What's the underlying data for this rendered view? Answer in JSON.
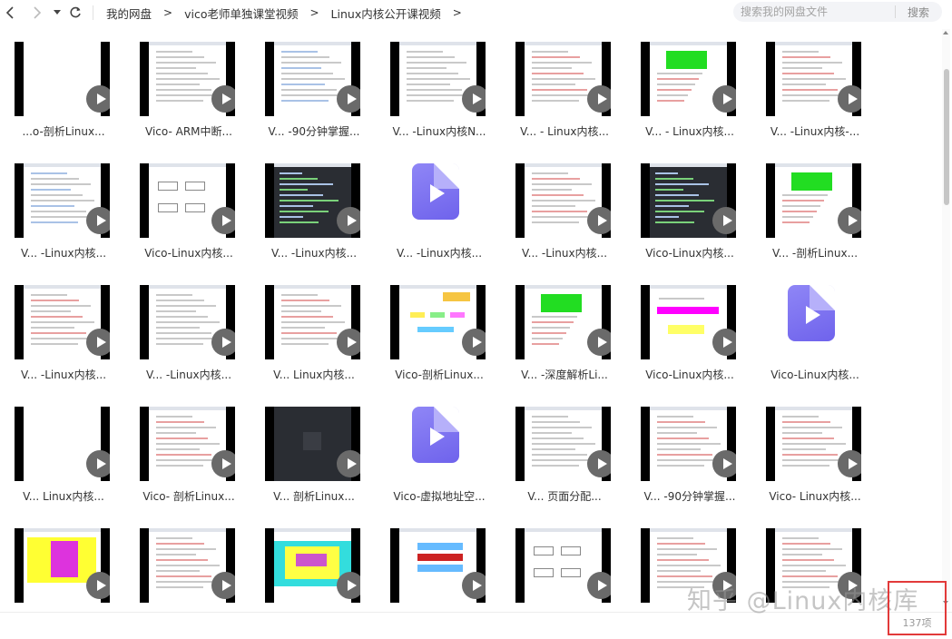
{
  "nav": {
    "back_icon": "chevron-left-icon",
    "forward_icon": "chevron-right-icon",
    "dropdown_icon": "caret-down-icon",
    "refresh_icon": "refresh-icon"
  },
  "breadcrumb": {
    "items": [
      "我的网盘",
      "vico老师单独课堂视频",
      "Linux内核公开课视频"
    ],
    "separator": ">"
  },
  "search": {
    "placeholder": "搜索我的网盘文件",
    "button_label": "搜索"
  },
  "files": [
    {
      "name": "...o-剖析Linux...",
      "kind": "video",
      "thumb": "blank"
    },
    {
      "name": "Vico- ARM中断...",
      "kind": "video",
      "thumb": "doc"
    },
    {
      "name": "V... -90分钟掌握...",
      "kind": "video",
      "thumb": "doc-blue"
    },
    {
      "name": "V... -Linux内核N...",
      "kind": "video",
      "thumb": "doc"
    },
    {
      "name": "V... - Linux内核...",
      "kind": "video",
      "thumb": "doc-red"
    },
    {
      "name": "V... - Linux内核...",
      "kind": "video",
      "thumb": "green-block"
    },
    {
      "name": "V... -Linux内核-...",
      "kind": "video",
      "thumb": "doc-red"
    },
    {
      "name": "V... -Linux内核...",
      "kind": "video",
      "thumb": "doc-blue"
    },
    {
      "name": "Vico-Linux内核...",
      "kind": "video",
      "thumb": "diagram"
    },
    {
      "name": "V... -Linux内核...",
      "kind": "video",
      "thumb": "code"
    },
    {
      "name": "V... -Linux内核...",
      "kind": "file",
      "thumb": "video-file"
    },
    {
      "name": "V... -Linux内核...",
      "kind": "video",
      "thumb": "doc-red"
    },
    {
      "name": "Vico-Linux内核...",
      "kind": "video",
      "thumb": "code"
    },
    {
      "name": "V... -剖析Linux...",
      "kind": "video",
      "thumb": "green-block"
    },
    {
      "name": "V... -Linux内核...",
      "kind": "video",
      "thumb": "doc-red"
    },
    {
      "name": "V... -Linux内核...",
      "kind": "video",
      "thumb": "doc"
    },
    {
      "name": "V... Linux内核...",
      "kind": "video",
      "thumb": "doc-red"
    },
    {
      "name": "Vico-剖析Linux...",
      "kind": "video",
      "thumb": "color-diagram"
    },
    {
      "name": "V... -深度解析Li...",
      "kind": "video",
      "thumb": "green-block"
    },
    {
      "name": "Vico-Linux内核...",
      "kind": "video",
      "thumb": "magenta"
    },
    {
      "name": "Vico-Linux内核...",
      "kind": "file",
      "thumb": "video-file"
    },
    {
      "name": "V... Linux内核...",
      "kind": "video",
      "thumb": "blank"
    },
    {
      "name": "Vico- 剖析Linux...",
      "kind": "video",
      "thumb": "doc-red"
    },
    {
      "name": "V... 剖析Linux...",
      "kind": "video",
      "thumb": "dark"
    },
    {
      "name": "Vico-虚拟地址空...",
      "kind": "file",
      "thumb": "video-file"
    },
    {
      "name": "V... 页面分配...",
      "kind": "video",
      "thumb": "doc"
    },
    {
      "name": "V... -90分钟掌握...",
      "kind": "video",
      "thumb": "doc-red"
    },
    {
      "name": "Vico- Linux内核...",
      "kind": "video",
      "thumb": "doc-red"
    },
    {
      "name": "",
      "kind": "video",
      "thumb": "yellow"
    },
    {
      "name": "",
      "kind": "video",
      "thumb": "doc-red"
    },
    {
      "name": "",
      "kind": "video",
      "thumb": "yellow-cyan"
    },
    {
      "name": "",
      "kind": "video",
      "thumb": "table-red"
    },
    {
      "name": "",
      "kind": "video",
      "thumb": "diagram"
    },
    {
      "name": "",
      "kind": "video",
      "thumb": "doc-red"
    },
    {
      "name": "",
      "kind": "video",
      "thumb": "doc-red"
    }
  ],
  "status": {
    "count_label": "137项"
  },
  "watermark": "知乎 @Linux内核库",
  "colors": {
    "accent_file": "#7b70f0",
    "highlight_box": "#e23a3a"
  }
}
